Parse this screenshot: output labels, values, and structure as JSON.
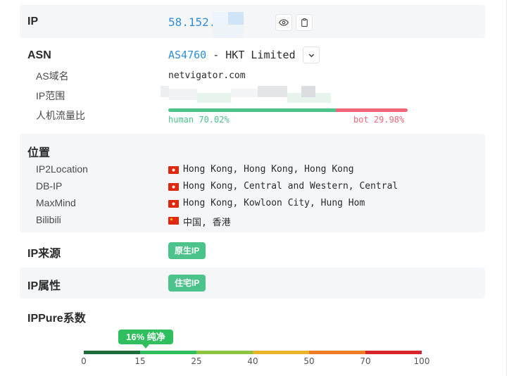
{
  "ip": {
    "label": "IP",
    "value_visible": "58.152."
  },
  "asn": {
    "label": "ASN",
    "asn_link": "AS4760",
    "asn_name": " - HKT Limited",
    "domain_label": "AS域名",
    "domain_value": "netvigator.com",
    "range_label": "IP范围",
    "traffic_label": "人机流量比",
    "human_text": "human 70.02%",
    "bot_text": "bot 29.98%",
    "human_ratio": 0.7002,
    "bot_ratio": 0.2998,
    "human_color": "#4cc38a",
    "bot_color": "#f0657a"
  },
  "location": {
    "label": "位置",
    "items": [
      {
        "source": "IP2Location",
        "flag": "hk-flag",
        "value": "Hong Kong, Hong Kong, Hong Kong"
      },
      {
        "source": "DB-IP",
        "flag": "hk-flag",
        "value": "Hong Kong, Central and Western, Central"
      },
      {
        "source": "MaxMind",
        "flag": "hk-flag",
        "value": "Hong Kong, Kowloon City, Hung Hom"
      },
      {
        "source": "Bilibili",
        "flag": "cn-flag",
        "value": "中国, 香港"
      }
    ]
  },
  "ip_source": {
    "label": "IP来源",
    "tag": "原生IP"
  },
  "ip_type": {
    "label": "IP属性",
    "tag": "住宅IP"
  },
  "score": {
    "label": "IPPure系数",
    "value": 16,
    "badge": "16% 纯净",
    "ticks": [
      "0",
      "15",
      "25",
      "40",
      "50",
      "70",
      "100"
    ],
    "segments": [
      {
        "from": 0,
        "to": 15,
        "color": "#1f6b3a"
      },
      {
        "from": 15,
        "to": 25,
        "color": "#2fbf5e"
      },
      {
        "from": 25,
        "to": 40,
        "color": "#8cc63f"
      },
      {
        "from": 40,
        "to": 50,
        "color": "#e8b42a"
      },
      {
        "from": 50,
        "to": 70,
        "color": "#ef7b25"
      },
      {
        "from": 70,
        "to": 100,
        "color": "#d7262b"
      }
    ],
    "badge_color": "#2fbf5e"
  }
}
